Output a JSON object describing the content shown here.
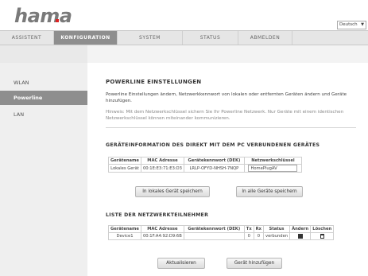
{
  "header": {
    "logo": "hama",
    "language": "Deutsch"
  },
  "nav": {
    "tabs": [
      {
        "label": "ASSISTENT"
      },
      {
        "label": "KONFIGURATION"
      },
      {
        "label": "SYSTEM"
      },
      {
        "label": "STATUS"
      },
      {
        "label": "ABMELDEN"
      }
    ]
  },
  "sidebar": {
    "items": [
      {
        "label": "WLAN"
      },
      {
        "label": "Powerline"
      },
      {
        "label": "LAN"
      }
    ]
  },
  "main": {
    "title": "POWERLINE EINSTELLUNGEN",
    "intro": "Powerline Einstellungen ändern, Netzwerkkennwort von lokalen oder entfernten Geräten ändern und Geräte hinzufügen.",
    "hint": "Hinweis: Mit dem Netzwerkschlüssel sichern Sie Ihr Powerline Netzwerk. Nur Geräte mit einem identischen Netzwerkschlüssel können miteinander kommunizieren.",
    "local_section_title": "GERÄTEINFORMATION DES DIREKT MIT DEM PC VERBUNDENEN GERÄTES",
    "local_table": {
      "headers": [
        "Gerätename",
        "MAC Adresse",
        "Gerätekennwort (DEK)",
        "Netzwerkschlüssel"
      ],
      "row": [
        "Lokales Gerät",
        "00:1E:E3:71:E3:D3",
        "LRLP-OFYD-NHSH-7NQP",
        "HomePlugAV"
      ]
    },
    "save_local_button": "In lokales Gerät speichern",
    "save_all_button": "In alle Geräte speichern",
    "network_section_title": "LISTE DER NETZWERKTEILNEHMER",
    "network_table": {
      "headers": [
        "Gerätename",
        "MAC Adresse",
        "Gerätekennwort (DEK)",
        "Tx",
        "Rx",
        "Status",
        "Ändern",
        "Löschen"
      ],
      "rows": [
        {
          "name": "Device1",
          "mac": "00:1F:A4:92:D9:6B",
          "dek": "",
          "tx": "0",
          "rx": "0",
          "status": "verbunden"
        }
      ]
    },
    "refresh_button": "Aktualisieren",
    "add_device_button": "Gerät hinzufügen"
  }
}
